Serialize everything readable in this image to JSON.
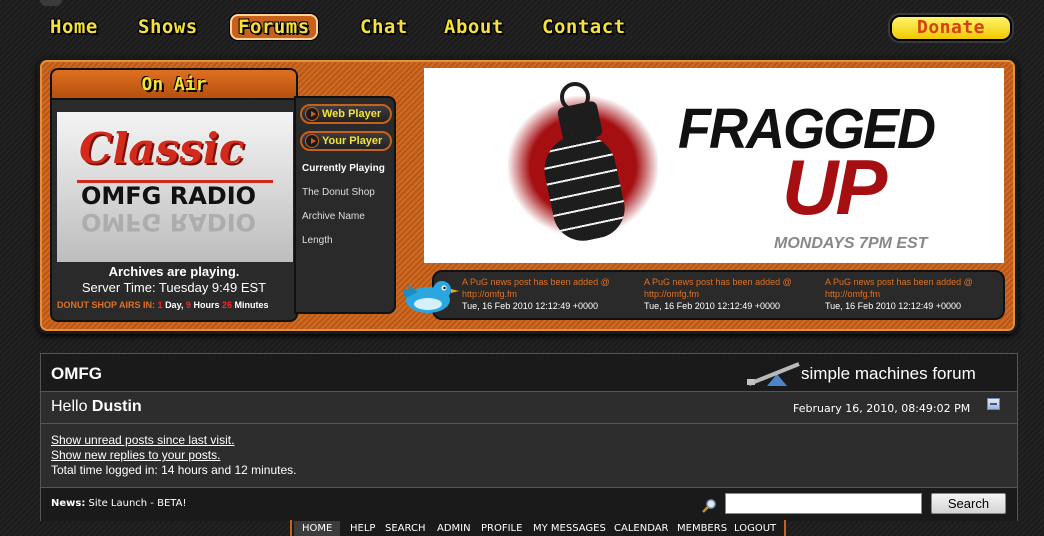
{
  "nav": {
    "items": [
      "Home",
      "Shows",
      "Forums",
      "Chat",
      "About",
      "Contact"
    ],
    "active": "Forums",
    "donate_label": "Donate"
  },
  "on_air": {
    "title": "On Air",
    "logo_line1": "Classic",
    "logo_line2": "OMFG RADIO",
    "status": "Archives are playing.",
    "server_time": "Server Time: Tuesday 9:49 EST",
    "countdown": {
      "label": "DONUT SHOP AIRS IN:",
      "days": "1",
      "days_label": "Day,",
      "hours": "9",
      "hours_label": "Hours",
      "minutes": "26",
      "minutes_label": "Minutes"
    }
  },
  "player": {
    "web_player": "Web Player",
    "your_player": "Your Player",
    "currently_playing": "Currently Playing",
    "show": "The Donut Shop",
    "archive_name": "Archive Name",
    "length": "Length"
  },
  "banner": {
    "line1": "FRAGGED",
    "line2": "UP",
    "schedule": "MONDAYS 7PM EST"
  },
  "tweets": [
    {
      "text": "A PuG news post has been added @ http://omfg.fm",
      "date": "Tue, 16 Feb 2010 12:12:49 +0000"
    },
    {
      "text": "A PuG news post has been added @ http://omfg.fm",
      "date": "Tue, 16 Feb 2010 12:12:49 +0000"
    },
    {
      "text": "A PuG news post has been added @ http://omfg.fm",
      "date": "Tue, 16 Feb 2010 12:12:49 +0000"
    }
  ],
  "forum": {
    "title": "OMFG",
    "brand": "simple machines forum",
    "hello": "Hello",
    "username": "Dustin",
    "datetime": "February 16, 2010, 08:49:02 PM",
    "link_unread": "Show unread posts since last visit.",
    "link_replies": "Show new replies to your posts.",
    "time_logged": "Total time logged in: 14 hours and 12 minutes.",
    "news_label": "News:",
    "news_text": "Site Launch - BETA!",
    "search_value": "",
    "search_button": "Search"
  },
  "menu": {
    "items": [
      "HOME",
      "HELP",
      "SEARCH",
      "ADMIN",
      "PROFILE",
      "MY MESSAGES",
      "CALENDAR",
      "MEMBERS",
      "LOGOUT"
    ],
    "active": "HOME"
  },
  "colors": {
    "accent_orange": "#c8611b",
    "nav_yellow": "#f4e13a",
    "banner_red": "#a50f12"
  }
}
